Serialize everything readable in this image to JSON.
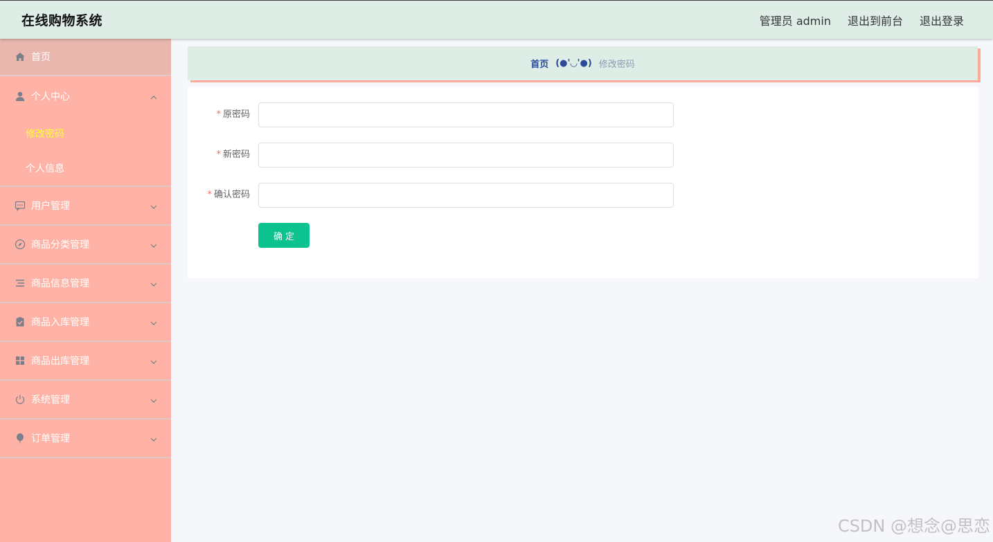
{
  "header": {
    "title": "在线购物系统",
    "user_label": "管理员 admin",
    "front_label": "退出到前台",
    "logout_label": "退出登录"
  },
  "sidebar": {
    "items": [
      {
        "label": "首页",
        "icon": "home-icon"
      },
      {
        "label": "个人中心",
        "icon": "user-icon",
        "expanded": true,
        "children": [
          {
            "label": "修改密码",
            "active": true
          },
          {
            "label": "个人信息"
          }
        ]
      },
      {
        "label": "用户管理",
        "icon": "chat-dots-icon"
      },
      {
        "label": "商品分类管理",
        "icon": "compass-icon"
      },
      {
        "label": "商品信息管理",
        "icon": "list-icon"
      },
      {
        "label": "商品入库管理",
        "icon": "clipboard-check-icon"
      },
      {
        "label": "商品出库管理",
        "icon": "grid-icon"
      },
      {
        "label": "系统管理",
        "icon": "power-icon"
      },
      {
        "label": "订单管理",
        "icon": "balloon-icon"
      }
    ]
  },
  "breadcrumb": {
    "home": "首页",
    "separator": "(●'◡'●)",
    "current": "修改密码"
  },
  "form": {
    "required_mark": "*",
    "old_password_label": "原密码",
    "old_password_value": "",
    "new_password_label": "新密码",
    "new_password_value": "",
    "confirm_password_label": "确认密码",
    "confirm_password_value": "",
    "submit_label": "确定"
  },
  "watermark": "CSDN @想念@思恋",
  "colors": {
    "header_bg": "#deeee6",
    "sidebar_bg": "#ffb3a6",
    "active_sub": "#ffff33",
    "primary_button": "#0cc28e",
    "breadcrumb_shadow": "#ffaa99"
  }
}
